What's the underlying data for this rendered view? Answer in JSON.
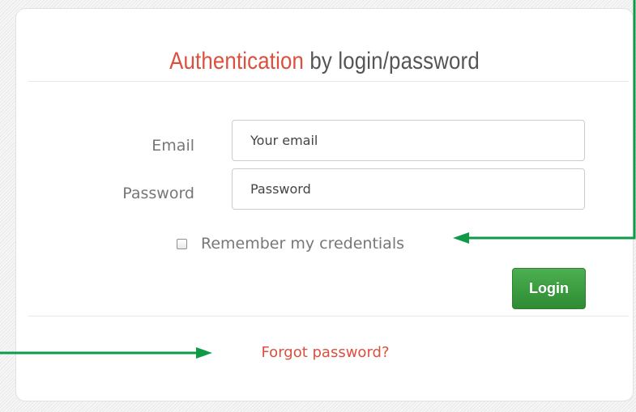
{
  "title": {
    "accent": "Authentication",
    "rest": " by login/password"
  },
  "form": {
    "email_label": "Email",
    "email_placeholder": "Your email",
    "email_value": "",
    "password_label": "Password",
    "password_placeholder": "Password",
    "password_value": "",
    "remember_label": "Remember my credentials",
    "remember_checked": false,
    "login_label": "Login"
  },
  "links": {
    "forgot_password": "Forgot password?"
  },
  "colors": {
    "accent": "#dd4f3d",
    "login_button": "#3a9c3f",
    "annotation_arrow": "#0e9a47"
  }
}
